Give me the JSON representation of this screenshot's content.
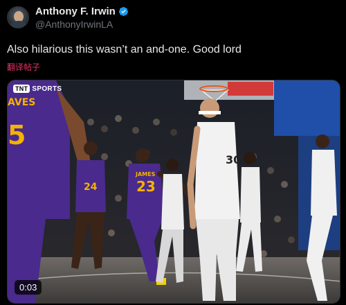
{
  "author": {
    "display_name": "Anthony F. Irwin",
    "handle": "@AnthonyIrwinLA",
    "verified_icon": "verified-badge-icon"
  },
  "tweet": {
    "text": "Also hilarious this wasn’t an and-one. Good lord",
    "translate_label": "翻译帖子"
  },
  "media": {
    "broadcaster": "SPORTS",
    "broadcaster_logo": "TNT",
    "duration": "0:03",
    "jersey_number_front": "23",
    "jersey_name_front": "JAMES",
    "jersey_number_left": "5",
    "jersey_name_left": "AVES",
    "jersey_number_mid": "24",
    "jersey_number_right": "30"
  },
  "colors": {
    "accent": "#1d9bf0",
    "translate": "#e8336a",
    "lakers_purple": "#4a2a8c",
    "lakers_gold": "#f5b301"
  }
}
